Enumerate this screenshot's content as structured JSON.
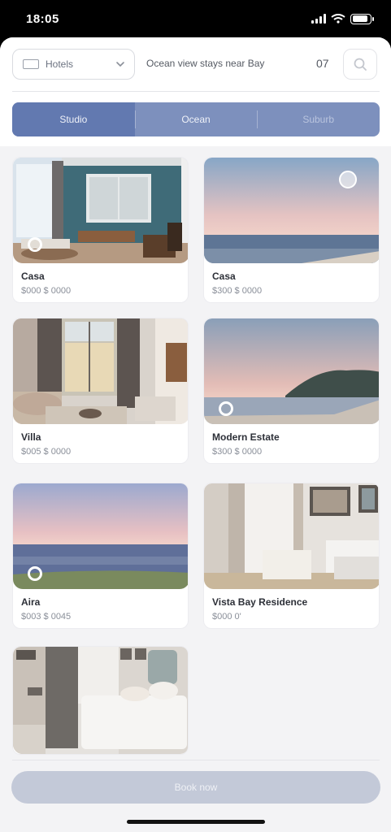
{
  "status": {
    "time": "18:05",
    "battery_level": 0.9
  },
  "header": {
    "dropdown_label": "Hotels",
    "title": "Ocean view stays near Bay",
    "count": "07"
  },
  "tabs": [
    {
      "label": "Studio",
      "active": true
    },
    {
      "label": "Ocean",
      "active": false
    },
    {
      "label": "Suburb",
      "active": false
    }
  ],
  "listings": [
    {
      "title": "Casa",
      "price": "$000 $ 0000",
      "scene": "living-room-teal"
    },
    {
      "title": "Casa",
      "price": "$300 $ 0000",
      "scene": "sea-dawn"
    },
    {
      "title": "Villa",
      "price": "$005 $ 0000",
      "scene": "lounge-window"
    },
    {
      "title": "Modern Estate",
      "price": "$300 $ 0000",
      "scene": "sea-headland"
    },
    {
      "title": "Aira",
      "price": "$003 $ 0045",
      "scene": "sea-pastel"
    },
    {
      "title": "Vista Bay Residence",
      "price": "$000 0'",
      "scene": "bright-room"
    },
    {
      "title": "",
      "price": "",
      "scene": "bedroom"
    }
  ],
  "cta": {
    "label": "Book now"
  },
  "icons": {
    "dropdown": "grid-icon",
    "chevron": "chevron-down-icon",
    "search": "search-icon"
  },
  "colors": {
    "accent": "#6279b0",
    "segment_bg": "#7d90bd",
    "cta": "#c3c9d8"
  }
}
